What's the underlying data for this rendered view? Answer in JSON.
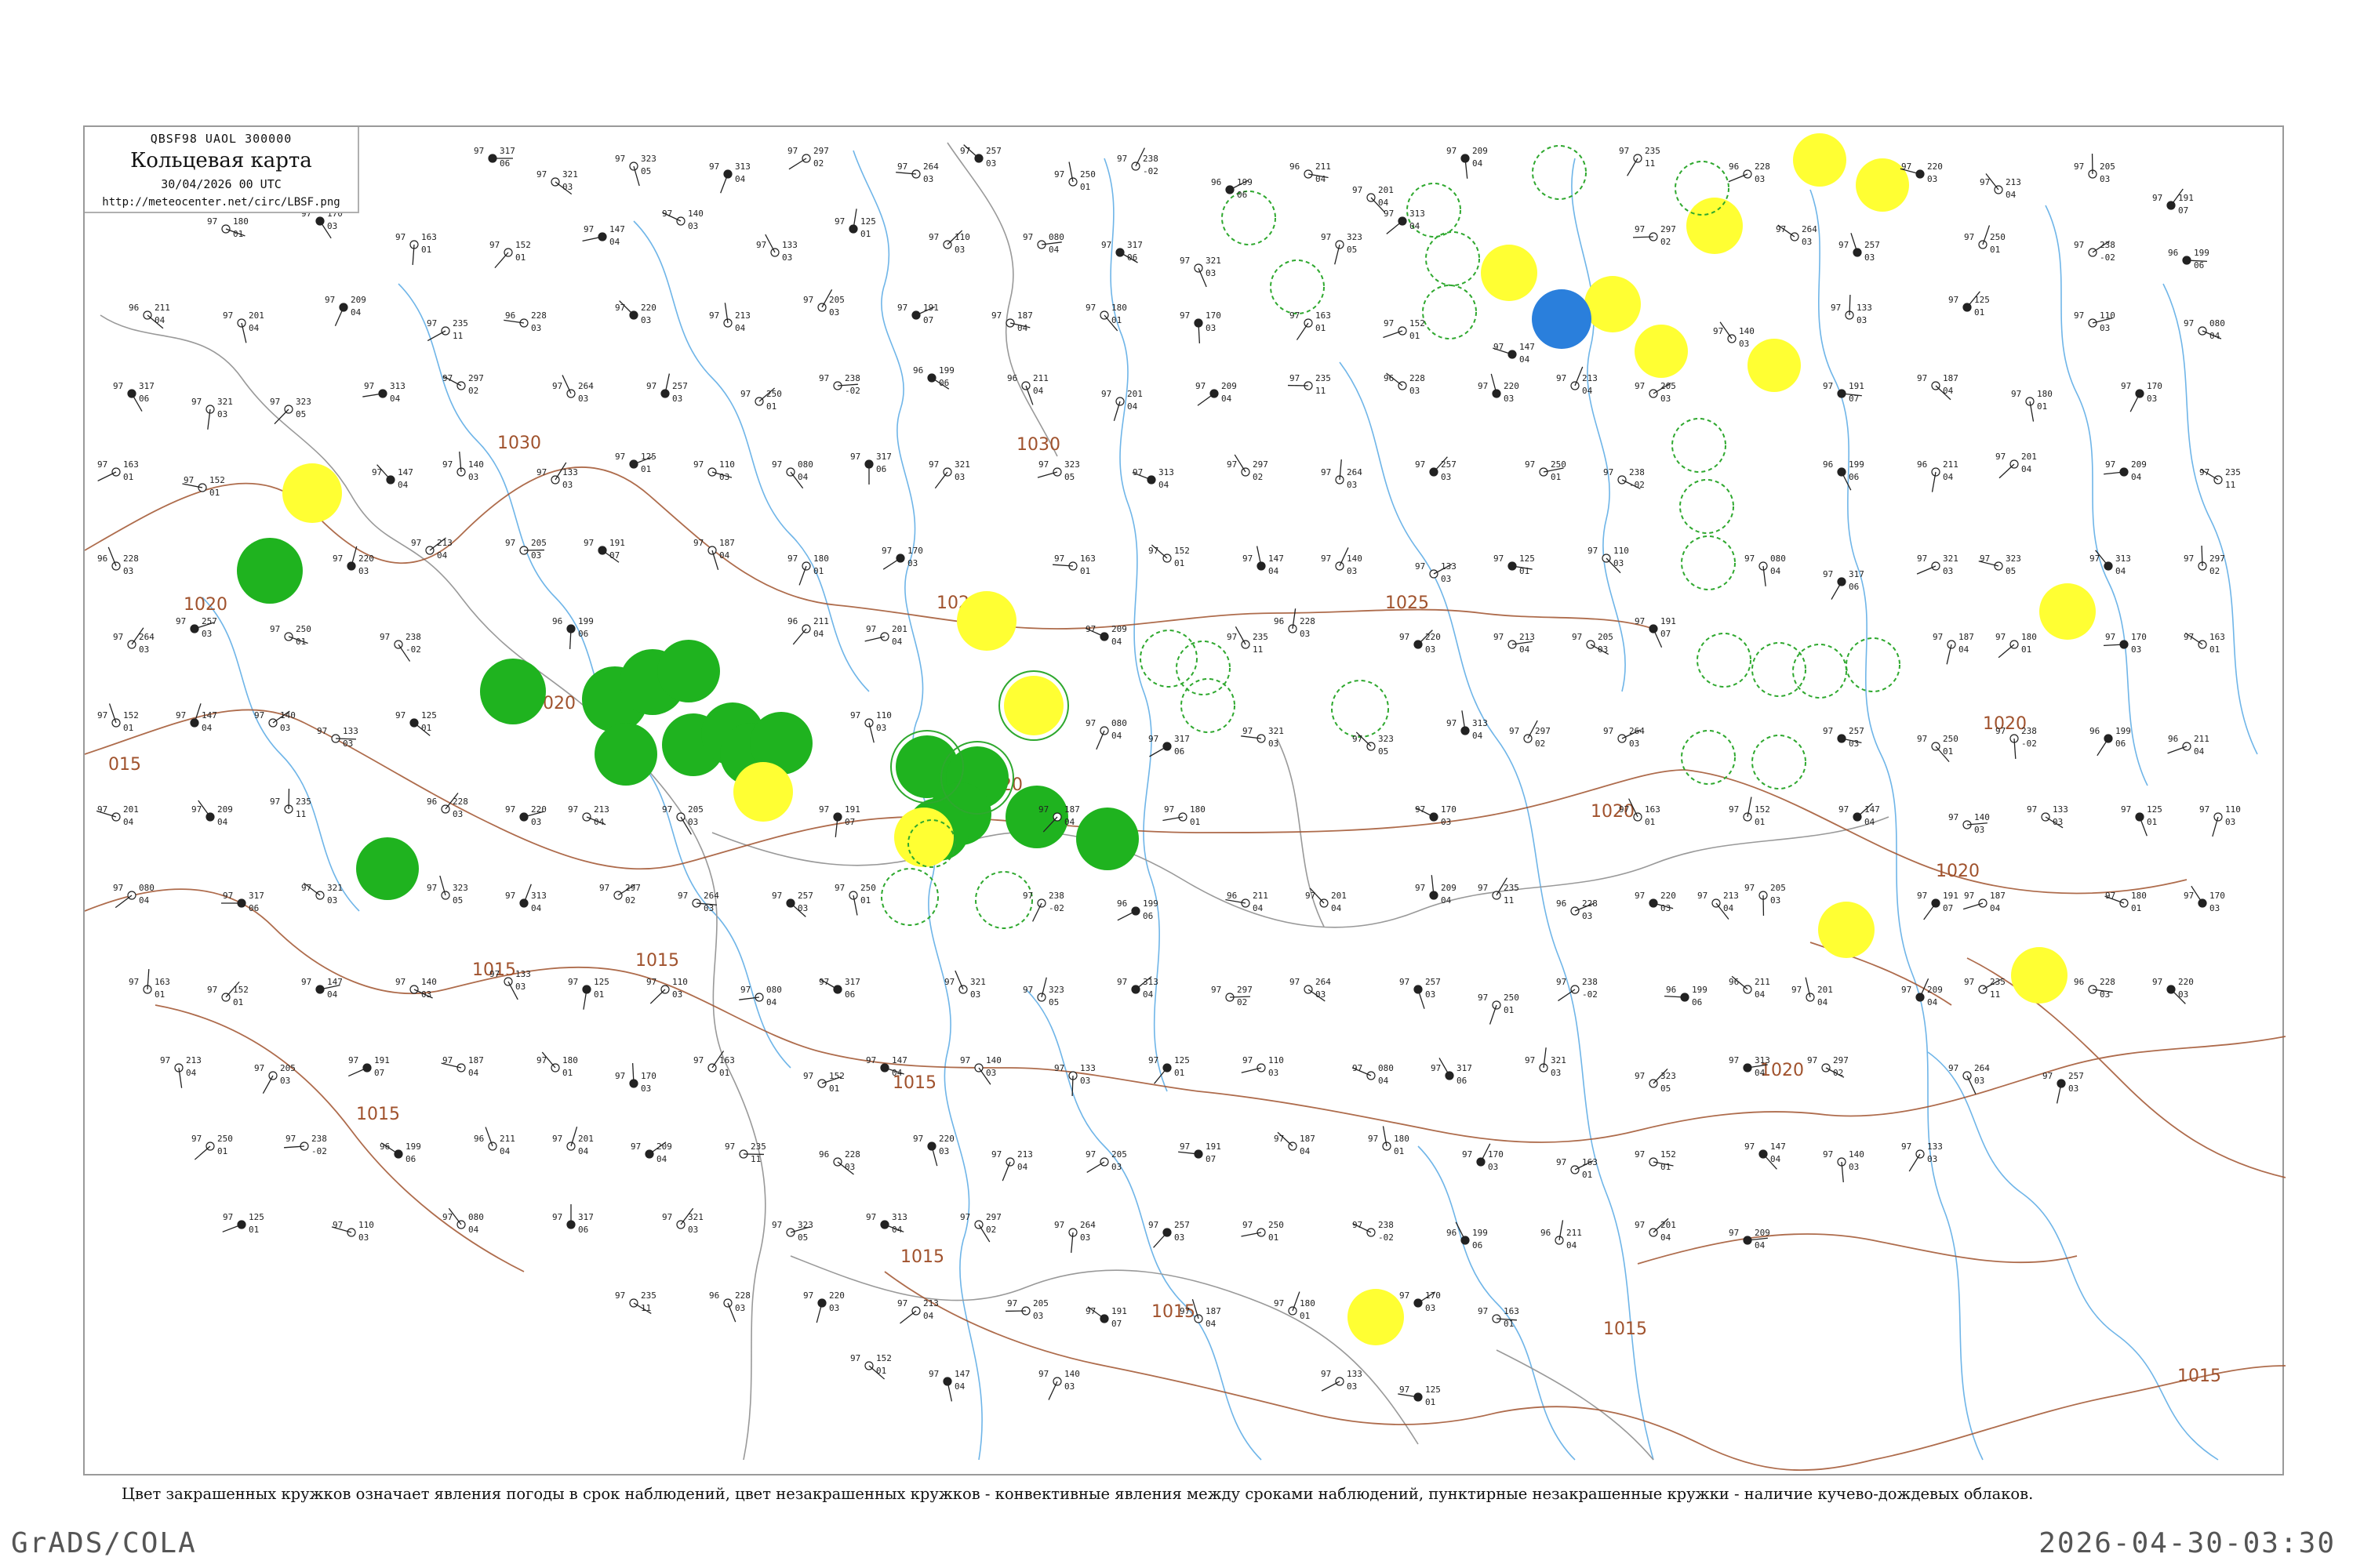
{
  "title_box": {
    "codes": "QBSF98  UAOL  300000",
    "title": "Кольцевая карта",
    "datetime": "30/04/2026 00 UTC",
    "url": "http://meteocenter.net/circ/LBSF.png"
  },
  "legend_caption": "Цвет закрашенных кружков означает явления погоды в срок наблюдений, цвет незакрашенных кружков - конвективные явления между сроками наблюдений, пунктирные незакрашенные кружки - наличие кучево-дождевых облаков.",
  "footer": {
    "left": "GrADS/COLA",
    "right": "2026-04-30-03:30"
  },
  "colors": {
    "rain_fill": "#1fb31f",
    "drizzle_fill": "#ffff33",
    "snow_fill": "#2a7fdc",
    "cb_dashed": "#2ea82e",
    "isobar": "#a0522d",
    "river": "#6fb5e8",
    "border": "#999999"
  },
  "isobars": [
    {
      "label": "1030"
    },
    {
      "label": "1030"
    },
    {
      "label": "1025"
    },
    {
      "label": "1025"
    },
    {
      "label": "1020"
    },
    {
      "label": "1020"
    },
    {
      "label": "1020"
    },
    {
      "label": "1020"
    },
    {
      "label": "1020"
    },
    {
      "label": "1020"
    },
    {
      "label": "1020"
    },
    {
      "label": "1015"
    },
    {
      "label": "1015"
    },
    {
      "label": "1015"
    },
    {
      "label": "1015"
    },
    {
      "label": "1015"
    },
    {
      "label": "1015"
    },
    {
      "label": "1015"
    },
    {
      "label": "1015"
    },
    {
      "label": "015"
    }
  ],
  "stations_sample": [
    {
      "p": "317",
      "t": "06",
      "td": "97"
    },
    {
      "p": "321",
      "t": "03",
      "td": "97"
    },
    {
      "p": "323",
      "t": "05",
      "td": "97"
    },
    {
      "p": "313",
      "t": "04",
      "td": "97"
    },
    {
      "p": "297",
      "t": "02",
      "td": "97"
    },
    {
      "p": "264",
      "t": "03",
      "td": "97"
    },
    {
      "p": "257",
      "t": "03",
      "td": "97"
    },
    {
      "p": "250",
      "t": "01",
      "td": "97"
    },
    {
      "p": "238",
      "t": "-02",
      "td": "97"
    },
    {
      "p": "199",
      "t": "06",
      "td": "96"
    },
    {
      "p": "211",
      "t": "04",
      "td": "96"
    },
    {
      "p": "201",
      "t": "04",
      "td": "97"
    },
    {
      "p": "209",
      "t": "04",
      "td": "97"
    },
    {
      "p": "235",
      "t": "11",
      "td": "97"
    },
    {
      "p": "228",
      "t": "03",
      "td": "96"
    },
    {
      "p": "220",
      "t": "03",
      "td": "97"
    },
    {
      "p": "213",
      "t": "04",
      "td": "97"
    },
    {
      "p": "205",
      "t": "03",
      "td": "97"
    },
    {
      "p": "191",
      "t": "07",
      "td": "97"
    },
    {
      "p": "187",
      "t": "04",
      "td": "97"
    },
    {
      "p": "180",
      "t": "01",
      "td": "97"
    },
    {
      "p": "170",
      "t": "03",
      "td": "97"
    },
    {
      "p": "163",
      "t": "01",
      "td": "97"
    },
    {
      "p": "152",
      "t": "01",
      "td": "97"
    },
    {
      "p": "147",
      "t": "04",
      "td": "97"
    },
    {
      "p": "140",
      "t": "03",
      "td": "97"
    },
    {
      "p": "133",
      "t": "03",
      "td": "97"
    },
    {
      "p": "125",
      "t": "01",
      "td": "97"
    },
    {
      "p": "110",
      "t": "03",
      "td": "97"
    },
    {
      "p": "080",
      "t": "04",
      "td": "97"
    }
  ]
}
